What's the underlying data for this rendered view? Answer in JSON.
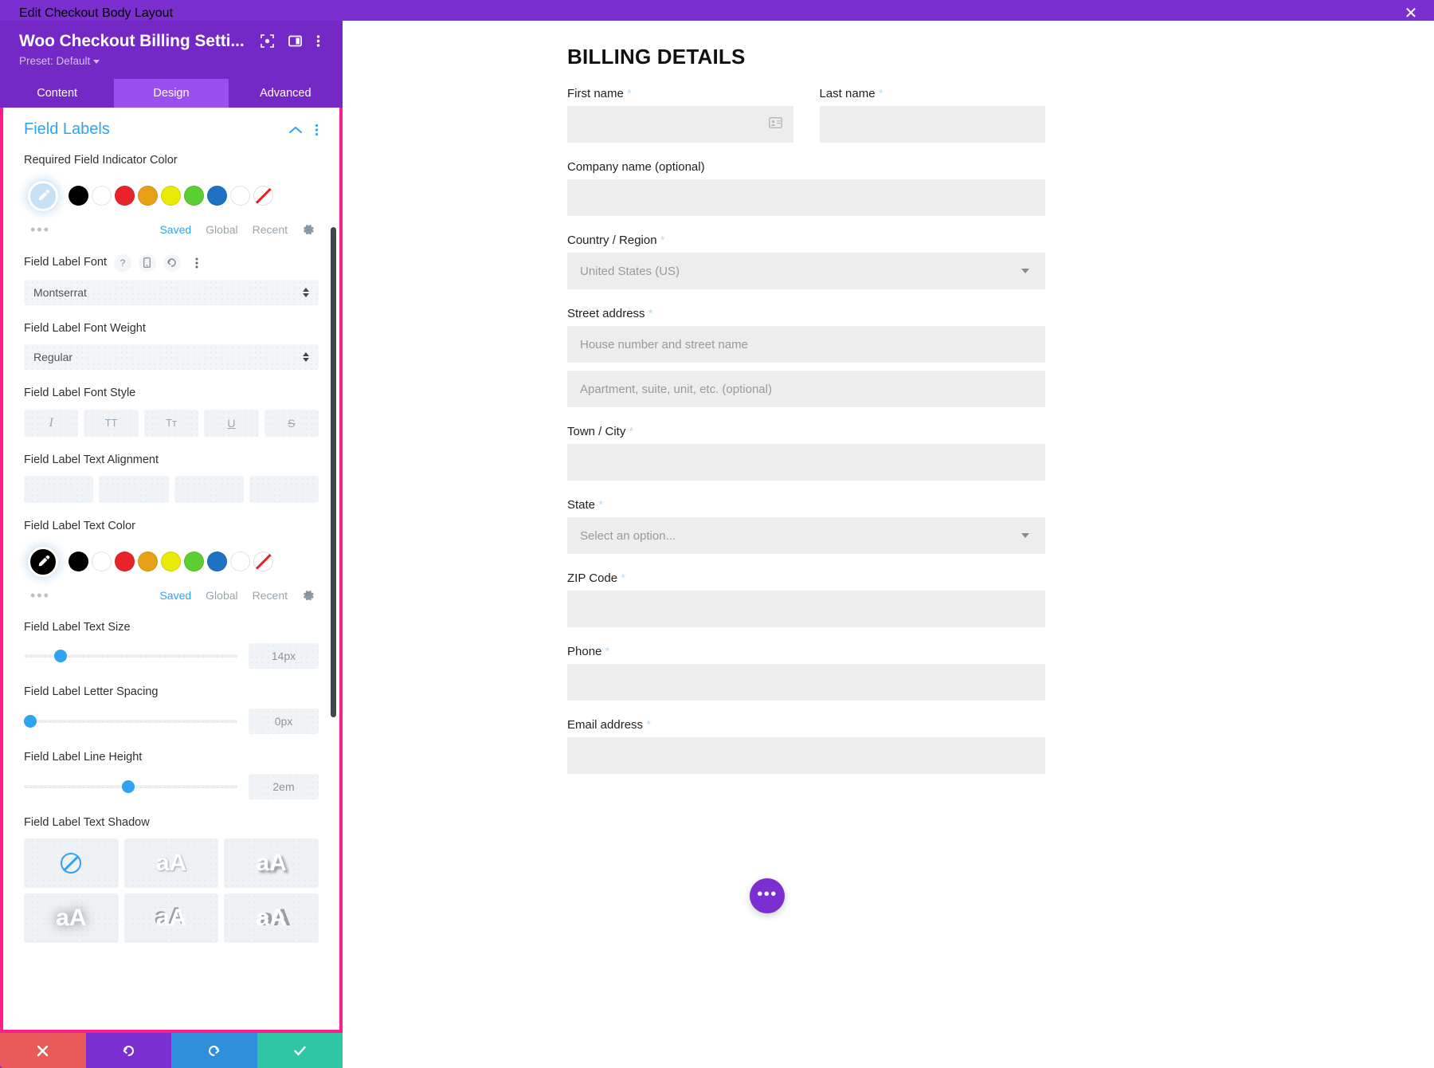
{
  "topbar": {
    "title": "Edit Checkout Body Layout",
    "close_icon": "close-icon"
  },
  "panel": {
    "module_title": "Woo Checkout Billing Setti...",
    "preset_label": "Preset: Default",
    "head_icons": [
      "focus-icon",
      "layout-panel-icon",
      "more-vertical-icon"
    ],
    "tabs": [
      {
        "label": "Content",
        "active": false
      },
      {
        "label": "Design",
        "active": true
      },
      {
        "label": "Advanced",
        "active": false
      }
    ],
    "section": {
      "title": "Field Labels",
      "collapse_icon": "chevron-up-icon",
      "more_icon": "more-vertical-icon"
    },
    "controls": {
      "required_indicator_color": {
        "label": "Required Field Indicator Color",
        "picker_color": "#c6e0f5",
        "swatches": [
          "#000000",
          "#ffffff",
          "#e8232a",
          "#e8a117",
          "#eaea07",
          "#5bcf31",
          "#1d72c4",
          "#ffffff",
          "none"
        ],
        "links": [
          {
            "label": "Saved",
            "active": true
          },
          {
            "label": "Global",
            "active": false
          },
          {
            "label": "Recent",
            "active": false
          }
        ],
        "settings_icon": "gear-icon",
        "more_dots": "•••"
      },
      "font": {
        "label": "Field Label Font",
        "value": "Montserrat",
        "icons": [
          "help-icon",
          "mobile-icon",
          "reset-icon",
          "more-vertical-icon"
        ]
      },
      "font_weight": {
        "label": "Field Label Font Weight",
        "value": "Regular"
      },
      "font_style": {
        "label": "Field Label Font Style",
        "options": [
          "I",
          "TT",
          "Tᴛ",
          "U",
          "S"
        ]
      },
      "text_alignment": {
        "label": "Field Label Text Alignment",
        "options": [
          "align-left-icon",
          "align-center-icon",
          "align-right-icon",
          "align-justify-icon"
        ]
      },
      "text_color": {
        "label": "Field Label Text Color",
        "picker_color": "#000000",
        "swatches": [
          "#000000",
          "#ffffff",
          "#e8232a",
          "#e8a117",
          "#eaea07",
          "#5bcf31",
          "#1d72c4",
          "#ffffff",
          "none"
        ],
        "links": [
          {
            "label": "Saved",
            "active": true
          },
          {
            "label": "Global",
            "active": false
          },
          {
            "label": "Recent",
            "active": false
          }
        ],
        "settings_icon": "gear-icon",
        "more_dots": "•••"
      },
      "text_size": {
        "label": "Field Label Text Size",
        "value": "14px",
        "knob_pct": 15
      },
      "letter_spacing": {
        "label": "Field Label Letter Spacing",
        "value": "0px",
        "knob_pct": 0
      },
      "line_height": {
        "label": "Field Label Line Height",
        "value": "2em",
        "knob_pct": 48
      },
      "text_shadow": {
        "label": "Field Label Text Shadow",
        "options": [
          "none",
          "aA",
          "aA",
          "aA",
          "aA",
          "aA"
        ]
      }
    },
    "actions": [
      {
        "name": "cancel-button",
        "icon": "close-icon"
      },
      {
        "name": "undo-button",
        "icon": "undo-icon"
      },
      {
        "name": "redo-button",
        "icon": "redo-icon"
      },
      {
        "name": "save-button",
        "icon": "check-icon"
      }
    ]
  },
  "preview": {
    "heading": "BILLING DETAILS",
    "fields": [
      {
        "label": "First name",
        "required": true,
        "value": "",
        "placeholder": "",
        "type": "text",
        "icon": "contact-card-icon"
      },
      {
        "label": "Last name",
        "required": true,
        "value": "",
        "placeholder": "",
        "type": "text"
      },
      {
        "label": "Company name (optional)",
        "required": false,
        "value": "",
        "placeholder": "",
        "type": "text"
      },
      {
        "label": "Country / Region",
        "required": true,
        "value": "United States (US)",
        "placeholder": "United States (US)",
        "type": "select"
      },
      {
        "label": "Street address",
        "required": true,
        "value": "",
        "placeholder": "House number and street name",
        "type": "text"
      },
      {
        "label": "",
        "required": false,
        "value": "",
        "placeholder": "Apartment, suite, unit, etc. (optional)",
        "type": "text"
      },
      {
        "label": "Town / City",
        "required": true,
        "value": "",
        "placeholder": "",
        "type": "text"
      },
      {
        "label": "State",
        "required": true,
        "value": "Select an option...",
        "placeholder": "Select an option...",
        "type": "select"
      },
      {
        "label": "ZIP Code",
        "required": true,
        "value": "",
        "placeholder": "",
        "type": "text"
      },
      {
        "label": "Phone",
        "required": true,
        "value": "",
        "placeholder": "",
        "type": "text"
      },
      {
        "label": "Email address",
        "required": true,
        "value": "",
        "placeholder": "",
        "type": "text"
      }
    ],
    "fab": {
      "icon": "more-horizontal-icon",
      "label": "•••"
    }
  },
  "colors": {
    "brand_purple": "#7429c6",
    "accent_blue": "#2ea3f2",
    "highlight_pink": "#ff1d8e",
    "cancel_red": "#eb5a5a",
    "save_green": "#2ec6a5",
    "redo_blue": "#2f8fdc"
  }
}
